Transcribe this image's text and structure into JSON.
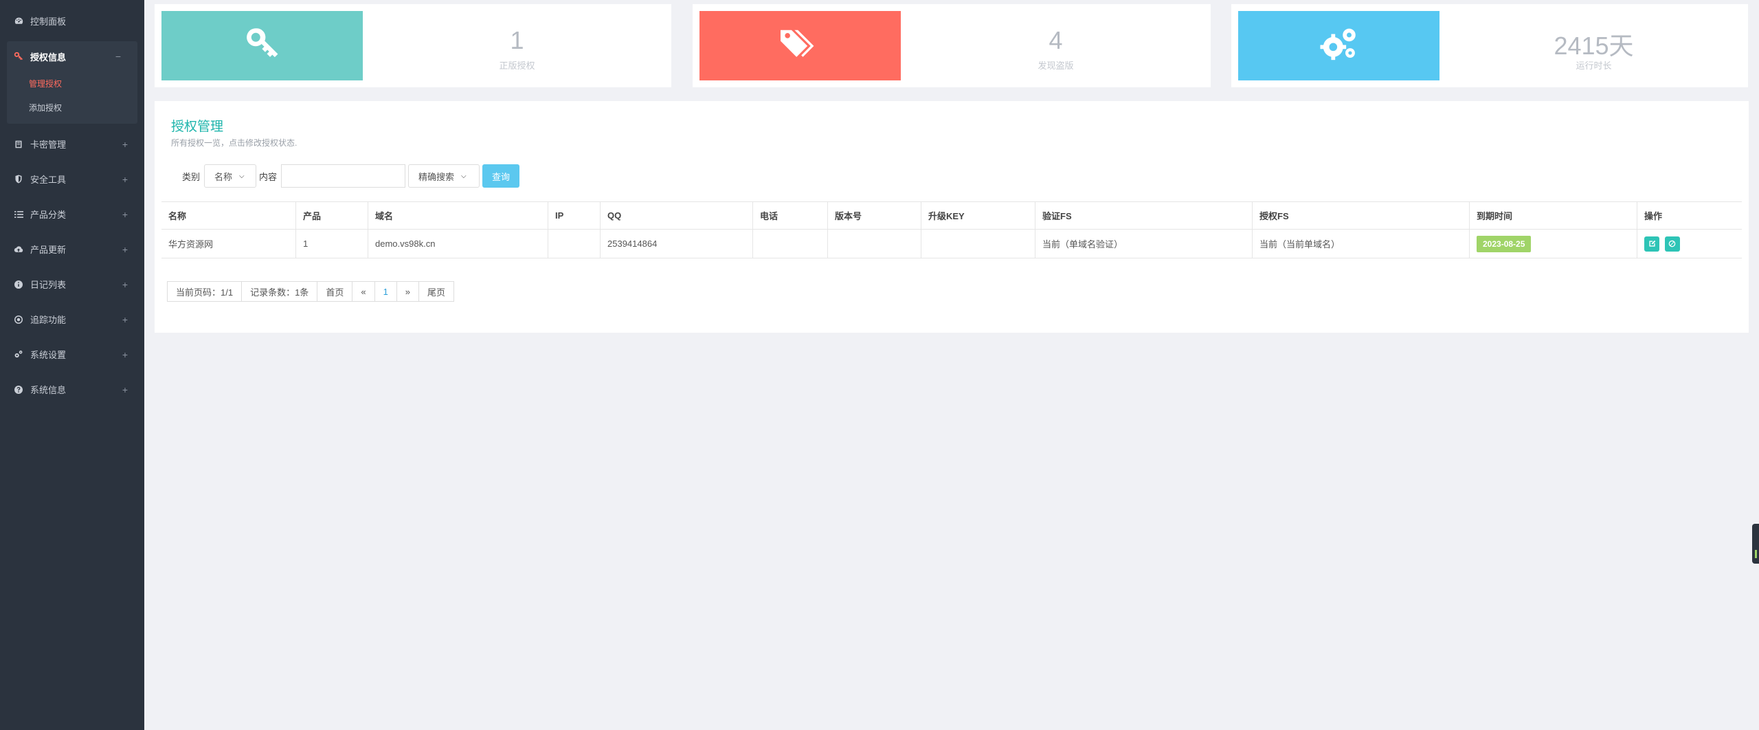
{
  "sidebar": {
    "items": [
      {
        "label": "控制面板",
        "icon": "dashboard-icon"
      },
      {
        "label": "授权信息",
        "icon": "key-icon",
        "toggle": "−"
      },
      {
        "label": "卡密管理",
        "icon": "card-icon",
        "toggle": "+"
      },
      {
        "label": "安全工具",
        "icon": "shield-icon",
        "toggle": "+"
      },
      {
        "label": "产品分类",
        "icon": "list-icon",
        "toggle": "+"
      },
      {
        "label": "产品更新",
        "icon": "cloud-upload-icon",
        "toggle": "+"
      },
      {
        "label": "日记列表",
        "icon": "info-icon",
        "toggle": "+"
      },
      {
        "label": "追踪功能",
        "icon": "target-icon",
        "toggle": "+"
      },
      {
        "label": "系统设置",
        "icon": "gears-icon",
        "toggle": "+"
      },
      {
        "label": "系统信息",
        "icon": "question-icon",
        "toggle": "+"
      }
    ],
    "sub_items": [
      {
        "label": "管理授权"
      },
      {
        "label": "添加授权"
      }
    ]
  },
  "stats": [
    {
      "value": "1",
      "label": "正版授权",
      "color": "#6ecdc8",
      "icon": "key-icon"
    },
    {
      "value": "4",
      "label": "发现盗版",
      "color": "#ff6c60",
      "icon": "tags-icon"
    },
    {
      "value": "2415天",
      "label": "运行时长",
      "color": "#57c8f2",
      "icon": "gears-icon"
    }
  ],
  "panel": {
    "title": "授权管理",
    "subtitle": "所有授权一览，点击修改授权状态.",
    "filter": {
      "type_label": "类别",
      "type_value": "名称",
      "content_label": "内容",
      "mode_value": "精确搜索",
      "query_label": "查询"
    }
  },
  "table": {
    "headers": [
      "名称",
      "产品",
      "域名",
      "IP",
      "QQ",
      "电话",
      "版本号",
      "升级KEY",
      "验证FS",
      "授权FS",
      "到期时间",
      "操作"
    ],
    "rows": [
      {
        "name": "华方资源网",
        "product": "1",
        "domain": "demo.vs98k.cn",
        "ip": "",
        "qq": "2539414864",
        "phone": "",
        "version": "",
        "upgrade_key": "",
        "verify_fs": "当前（单域名验证）",
        "auth_fs": "当前（当前单域名）",
        "expire": "2023-08-25"
      }
    ]
  },
  "pager": {
    "current_page": "当前页码：1/1",
    "record_count": "记录条数：1条",
    "first": "首页",
    "prev": "«",
    "page": "1",
    "next": "»",
    "last": "尾页"
  }
}
